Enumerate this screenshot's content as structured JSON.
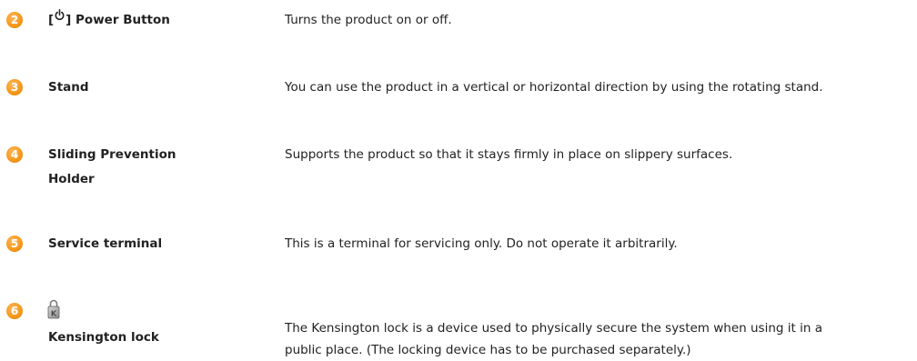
{
  "items": [
    {
      "number": "2",
      "term_prefix": "[",
      "term_suffix": "] Power Button",
      "icon": "power-icon",
      "description": "Turns the product on or off."
    },
    {
      "number": "3",
      "term": "Stand",
      "description": "You can use the product in a vertical or horizontal direction by using the rotating stand."
    },
    {
      "number": "4",
      "term_line1": "Sliding Prevention",
      "term_line2": "Holder",
      "description": "Supports the product so that it stays firmly in place on slippery surfaces."
    },
    {
      "number": "5",
      "term": "Service terminal",
      "description": "This is a terminal for servicing only. Do not operate it arbitrarily."
    },
    {
      "number": "6",
      "term": "Kensington lock",
      "icon": "kensington-lock-icon",
      "description_line1": "The Kensington lock is a device used to physically secure the system when using it in a",
      "description_line2": "public place. (The locking device has to be purchased separately.)"
    }
  ],
  "colors": {
    "badge": "#f59a1c",
    "text": "#222222"
  }
}
